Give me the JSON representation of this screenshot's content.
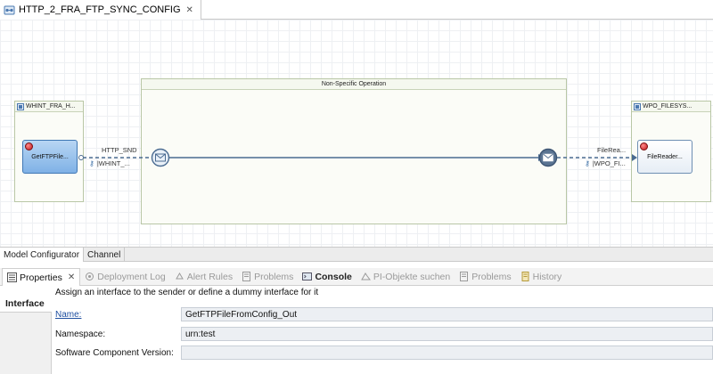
{
  "editor": {
    "tab_title": "HTTP_2_FRA_FTP_SYNC_CONFIG",
    "close_glyph": "✕"
  },
  "diagram": {
    "sender_lane": "WHINT_FRA_H...",
    "operation_lane": "Non-Specific Operation",
    "receiver_lane": "WPO_FILESYS...",
    "sender_activity": "GetFTPFile...",
    "receiver_activity": "FileReader...",
    "left_connection": {
      "label": "HTTP_SND",
      "sub": "|WHINT_..."
    },
    "right_connection": {
      "label": "FileRea...",
      "sub": "|WPO_FI..."
    },
    "colors": {
      "line": "#4a6b91",
      "start_event": "#e9f0f8",
      "end_event": "#5a7492",
      "selected_activity": "#7fb1e6"
    }
  },
  "editor_tabs": [
    {
      "label": "Model Configurator",
      "active": true
    },
    {
      "label": "Channel",
      "active": false
    }
  ],
  "views": {
    "properties": "Properties",
    "deployment_log": "Deployment Log",
    "alert_rules": "Alert Rules",
    "problems1": "Problems",
    "console": "Console",
    "pi_objekte": "PI-Objekte suchen",
    "problems2": "Problems",
    "history": "History",
    "close_glyph": "✕"
  },
  "properties": {
    "hint": "Assign an interface to the sender or define a dummy interface for it",
    "side_tab": "Interface",
    "name_label": "Name:",
    "name_value": "GetFTPFileFromConfig_Out",
    "namespace_label": "Namespace:",
    "namespace_value": "urn:test",
    "swc_label": "Software Component Version:",
    "swc_value": ""
  }
}
